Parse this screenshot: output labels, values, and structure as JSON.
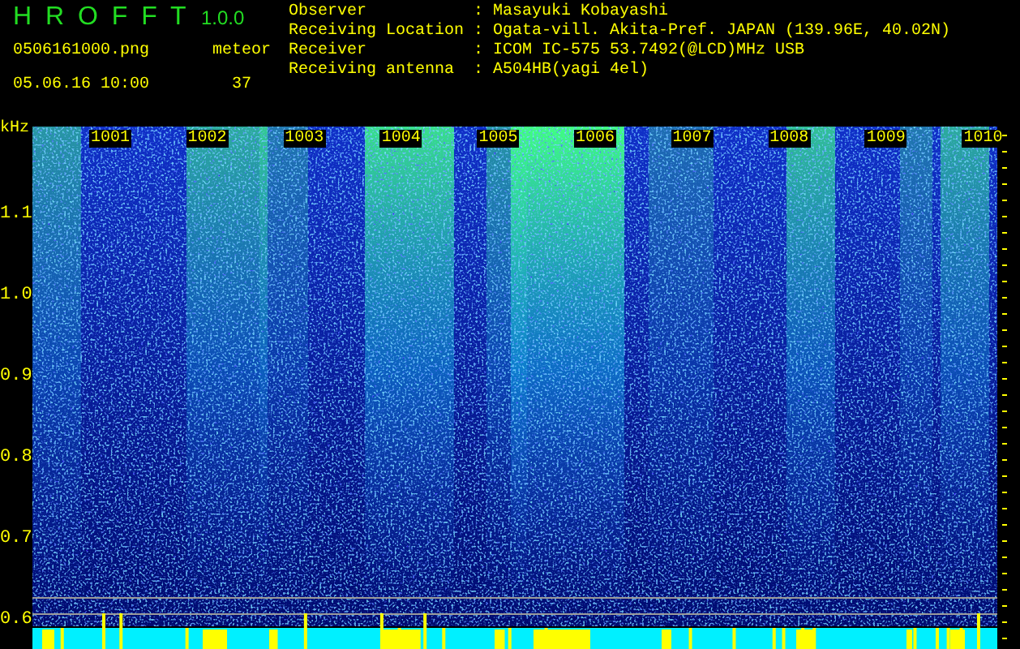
{
  "app": {
    "title": "H R O F F T",
    "version": "1.0.0"
  },
  "file": {
    "name": "0506161000.png",
    "timestamp": "05.06.16 10:00"
  },
  "meteor": {
    "label": "meteor",
    "count": "37"
  },
  "station": [
    {
      "label": "Observer",
      "separator": ":",
      "value": "Masayuki Kobayashi"
    },
    {
      "label": "Receiving Location",
      "separator": ":",
      "value": "Ogata-vill. Akita-Pref. JAPAN (139.96E, 40.02N)"
    },
    {
      "label": "Receiver",
      "separator": ":",
      "value": "ICOM IC-575 53.7492(@LCD)MHz USB"
    },
    {
      "label": "Receiving antenna",
      "separator": ":",
      "value": "A504HB(yagi 4el)"
    }
  ],
  "spectrogram": {
    "unit": "kHz",
    "y_labels": [
      "1.1",
      "1.0",
      "0.9",
      "0.8",
      "0.7",
      "0.6"
    ],
    "x_labels": [
      "1001",
      "1002",
      "1003",
      "1004",
      "1005",
      "1006",
      "1007",
      "1008",
      "1009",
      "1010"
    ]
  }
}
